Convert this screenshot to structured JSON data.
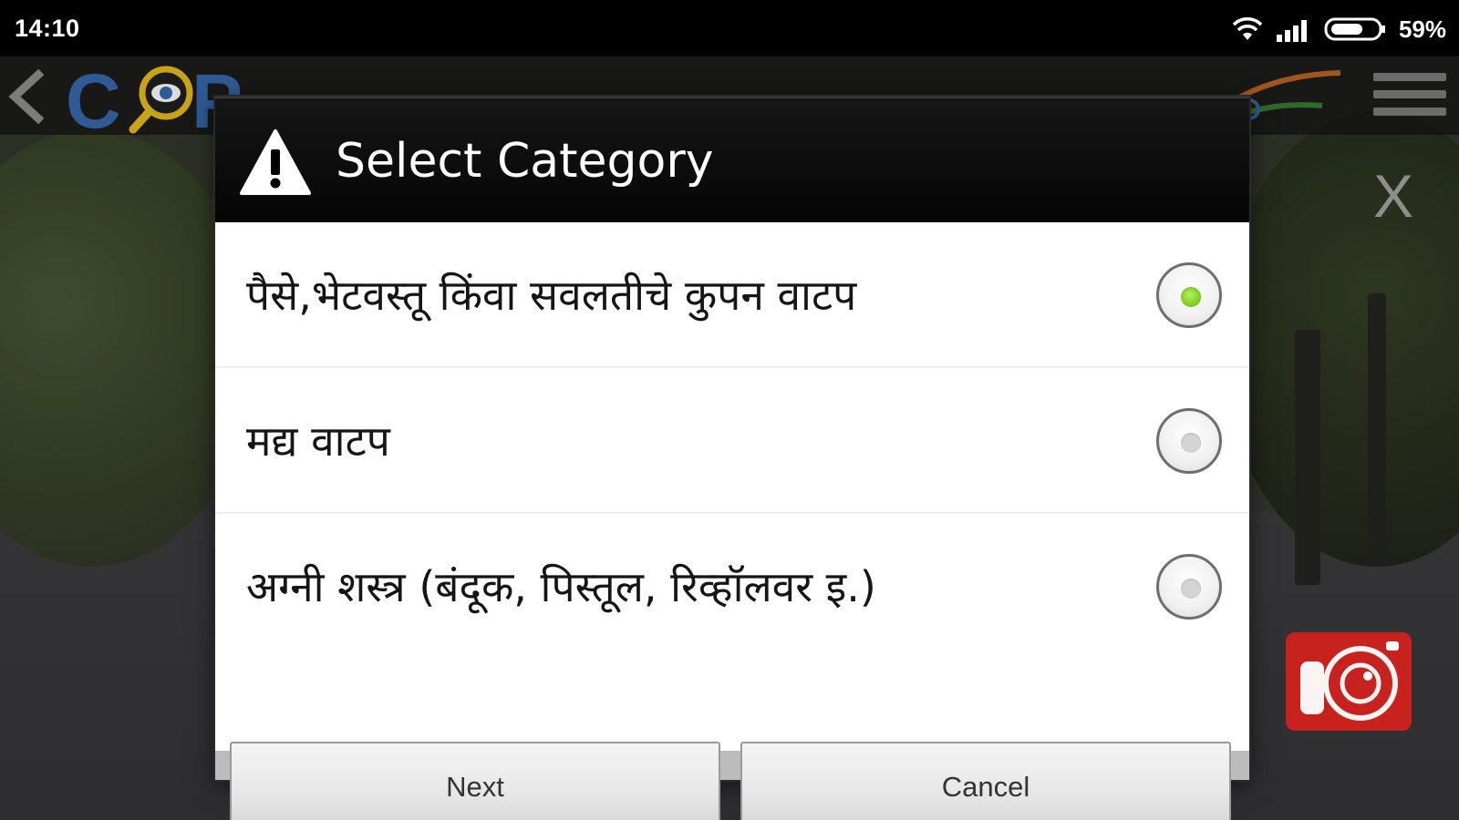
{
  "status_bar": {
    "time": "14:10",
    "battery_percent": "59%",
    "icons": [
      "wifi-icon",
      "signal-icon",
      "battery-icon"
    ]
  },
  "app_header": {
    "logo_text": "COP",
    "icons": [
      "back-icon",
      "logo",
      "flag-logo",
      "menu-icon"
    ]
  },
  "overlay": {
    "close_label": "X"
  },
  "dialog": {
    "title": "Select Category",
    "title_icon": "warning-icon",
    "options": [
      {
        "label": "पैसे,भेटवस्तू किंवा सवलतीचे कुपन वाटप",
        "checked": true
      },
      {
        "label": "मद्य वाटप",
        "checked": false
      },
      {
        "label": "अग्नी शस्त्र (बंदूक, पिस्तूल, रिव्हॉलवर इ.)",
        "checked": false
      }
    ],
    "buttons": {
      "next": "Next",
      "cancel": "Cancel"
    }
  },
  "colors": {
    "radio_checked": "#7ccf1b",
    "camera_button": "#c8221f",
    "dialog_header": "#0a0a0a",
    "logo_blue": "#2f66ad"
  }
}
